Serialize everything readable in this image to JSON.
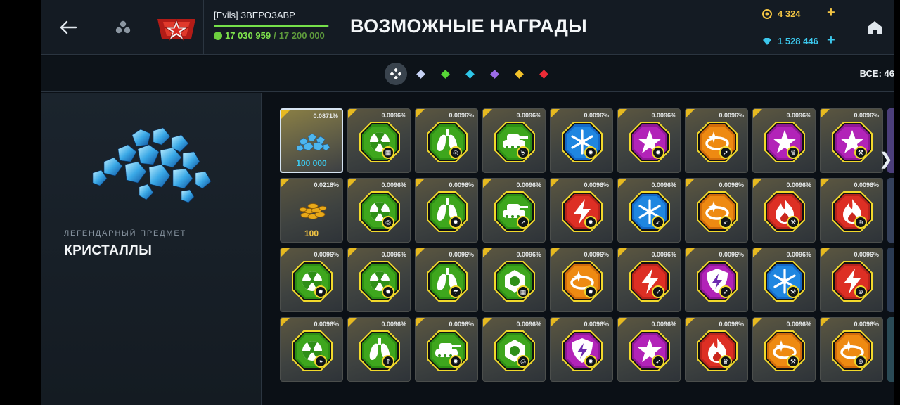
{
  "header": {
    "player_name": "[Evils] ЗВЕРОЗАВР",
    "xp_current": "17 030 959",
    "xp_separator": "/",
    "xp_max": "17 200 000",
    "xp_progress": 0.9902,
    "title": "ВОЗМОЖНЫЕ НАГРАДЫ",
    "coins": "4 324",
    "crystals": "1 528 446"
  },
  "filters": {
    "items": [
      {
        "color": "#ffffff",
        "active": true
      },
      {
        "color": "#c7d3f5"
      },
      {
        "color": "#57d836"
      },
      {
        "color": "#2ec6e8"
      },
      {
        "color": "#9b6be8"
      },
      {
        "color": "#f2c22a"
      },
      {
        "color": "#ee2b36"
      }
    ],
    "all_label": "ВСЕ: 46"
  },
  "detail": {
    "rarity": "ЛЕГЕНДАРНЫЙ ПРЕДМЕТ",
    "name": "КРИСТАЛЛЫ"
  },
  "grid": {
    "rows": [
      [
        {
          "kind": "crystals",
          "pct": "0.0871%",
          "amount": "100 000",
          "selected": true
        },
        {
          "kind": "hex",
          "theme": "green",
          "symbol": "radiation-icon",
          "badge": "grid-icon",
          "pct": "0.0096%"
        },
        {
          "kind": "hex",
          "theme": "green",
          "symbol": "lungs-icon",
          "badge": "target-icon",
          "pct": "0.0096%"
        },
        {
          "kind": "hex",
          "theme": "green",
          "symbol": "tank-icon",
          "badge": "shield-icon",
          "pct": "0.0096%"
        },
        {
          "kind": "hex",
          "theme": "blue",
          "symbol": "snowflake-icon",
          "badge": "gear-icon",
          "pct": "0.0096%"
        },
        {
          "kind": "hex",
          "theme": "purple",
          "symbol": "star-icon",
          "badge": "gear-icon",
          "pct": "0.0096%"
        },
        {
          "kind": "hex",
          "theme": "orange",
          "symbol": "ring-icon",
          "badge": "arrow-icon",
          "pct": "0.0096%"
        },
        {
          "kind": "hex",
          "theme": "purple",
          "symbol": "star-icon",
          "badge": "crown-icon",
          "pct": "0.0096%"
        },
        {
          "kind": "hex",
          "theme": "purple",
          "symbol": "star-icon",
          "badge": "wrench-icon",
          "pct": "0.0096%"
        }
      ],
      [
        {
          "kind": "coins",
          "pct": "0.0218%",
          "amount": "100"
        },
        {
          "kind": "hex",
          "theme": "green",
          "symbol": "radiation-icon",
          "badge": "target-icon",
          "pct": "0.0096%"
        },
        {
          "kind": "hex",
          "theme": "green",
          "symbol": "lungs-icon",
          "badge": "gear-icon",
          "pct": "0.0096%"
        },
        {
          "kind": "hex",
          "theme": "green",
          "symbol": "tank-icon",
          "badge": "arrow-icon",
          "pct": "0.0096%"
        },
        {
          "kind": "hex",
          "theme": "red",
          "symbol": "lightning-icon",
          "badge": "gear-icon",
          "pct": "0.0096%"
        },
        {
          "kind": "hex",
          "theme": "blue",
          "symbol": "snowflake-icon",
          "badge": "rocket-icon",
          "pct": "0.0096%"
        },
        {
          "kind": "hex",
          "theme": "orange",
          "symbol": "ring-icon",
          "badge": "rocket-icon",
          "pct": "0.0096%"
        },
        {
          "kind": "hex",
          "theme": "red",
          "symbol": "flame-icon",
          "badge": "wrench-icon",
          "pct": "0.0096%"
        },
        {
          "kind": "hex",
          "theme": "red",
          "symbol": "flame-icon",
          "badge": "crosshair-icon",
          "pct": "0.0096%"
        }
      ],
      [
        {
          "kind": "hex",
          "theme": "green",
          "symbol": "radiation-icon",
          "badge": "gear-icon",
          "pct": "0.0096%"
        },
        {
          "kind": "hex",
          "theme": "green",
          "symbol": "radiation-icon",
          "badge": "gear-icon",
          "pct": "0.0096%"
        },
        {
          "kind": "hex",
          "theme": "green",
          "symbol": "lungs-icon",
          "badge": "umbrella-icon",
          "pct": "0.0096%"
        },
        {
          "kind": "hex",
          "theme": "green",
          "symbol": "nut-icon",
          "badge": "grid-icon",
          "pct": "0.0096%"
        },
        {
          "kind": "hex",
          "theme": "orange",
          "symbol": "ring-icon",
          "badge": "gear-icon",
          "pct": "0.0096%"
        },
        {
          "kind": "hex",
          "theme": "red",
          "symbol": "lightning-icon",
          "badge": "rocket-icon",
          "pct": "0.0096%"
        },
        {
          "kind": "hex",
          "theme": "purple",
          "symbol": "shield-bolt-icon",
          "badge": "rocket-icon",
          "pct": "0.0096%"
        },
        {
          "kind": "hex",
          "theme": "blue",
          "symbol": "snowflake-icon",
          "badge": "wrench-icon",
          "pct": "0.0096%"
        },
        {
          "kind": "hex",
          "theme": "red",
          "symbol": "lightning-icon",
          "badge": "crosshair-icon",
          "pct": "0.0096%"
        }
      ],
      [
        {
          "kind": "hex",
          "theme": "green",
          "symbol": "radiation-icon",
          "badge": "leaf-icon",
          "pct": "0.0096%"
        },
        {
          "kind": "hex",
          "theme": "green",
          "symbol": "lungs-icon",
          "badge": "chevrons-icon",
          "pct": "0.0096%"
        },
        {
          "kind": "hex",
          "theme": "green",
          "symbol": "tank-icon",
          "badge": "gear-icon",
          "pct": "0.0096%"
        },
        {
          "kind": "hex",
          "theme": "green",
          "symbol": "nut-icon",
          "badge": "target-icon",
          "pct": "0.0096%"
        },
        {
          "kind": "hex",
          "theme": "purple",
          "symbol": "shield-bolt-icon",
          "badge": "gear-icon",
          "pct": "0.0096%"
        },
        {
          "kind": "hex",
          "theme": "purple",
          "symbol": "star-icon",
          "badge": "rocket-icon",
          "pct": "0.0096%"
        },
        {
          "kind": "hex",
          "theme": "red",
          "symbol": "flame-icon",
          "badge": "crown-icon",
          "pct": "0.0096%"
        },
        {
          "kind": "hex",
          "theme": "orange",
          "symbol": "ring-icon",
          "badge": "wrench-icon",
          "pct": "0.0096%"
        },
        {
          "kind": "hex",
          "theme": "orange",
          "symbol": "ring-icon",
          "badge": "crosshair-icon",
          "pct": "0.0096%"
        }
      ]
    ],
    "cutoff_colors": [
      "#4c3f7a",
      "#34405a",
      "#2a3a52",
      "#2a4a55"
    ]
  },
  "theme": {
    "green": "#3ea61d",
    "blue": "#1f86e0",
    "purple": "#b223b8",
    "orange": "#ee8a12",
    "red": "#dd2f24",
    "gold": "#f3c544",
    "cyan": "#3cc7ec"
  }
}
